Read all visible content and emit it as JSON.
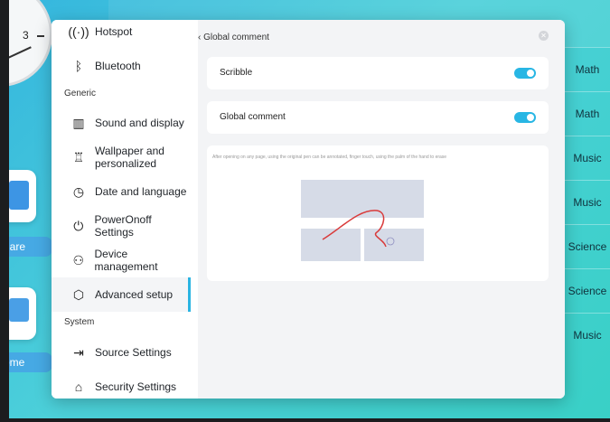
{
  "background": {
    "clock_numeral": "3",
    "apps": [
      {
        "label": "hare"
      },
      {
        "label": "ome"
      }
    ],
    "subjects": [
      "Math",
      "Math",
      "Music",
      "Music",
      "Science",
      "Science",
      "Music"
    ]
  },
  "sidebar": {
    "items_top": [
      {
        "label": "Hotspot",
        "icon": "hotspot-icon"
      },
      {
        "label": "Bluetooth",
        "icon": "bluetooth-icon"
      }
    ],
    "section_generic": "Generic",
    "items_generic": [
      {
        "label": "Sound and display",
        "icon": "sound-display-icon"
      },
      {
        "label": "Wallpaper and personalized",
        "icon": "wallpaper-icon"
      },
      {
        "label": "Date and language",
        "icon": "clock-icon"
      },
      {
        "label": "PowerOnoff Settings",
        "icon": "power-icon"
      },
      {
        "label": "Device management",
        "icon": "device-management-icon"
      },
      {
        "label": "Advanced setup",
        "icon": "advanced-setup-icon",
        "active": true
      }
    ],
    "section_system": "System",
    "items_system": [
      {
        "label": "Source Settings",
        "icon": "source-icon"
      },
      {
        "label": "Security Settings",
        "icon": "security-icon"
      }
    ]
  },
  "content": {
    "back_label": "Global comment",
    "cards": [
      {
        "label": "Scribble",
        "on": true
      },
      {
        "label": "Global comment",
        "on": true
      }
    ],
    "description": "After opening on any page, using the original pen can be annotated, finger touch, using the palm of the hand to erase",
    "colors": {
      "accent": "#28b6e4",
      "stroke": "#d93a3a"
    }
  }
}
